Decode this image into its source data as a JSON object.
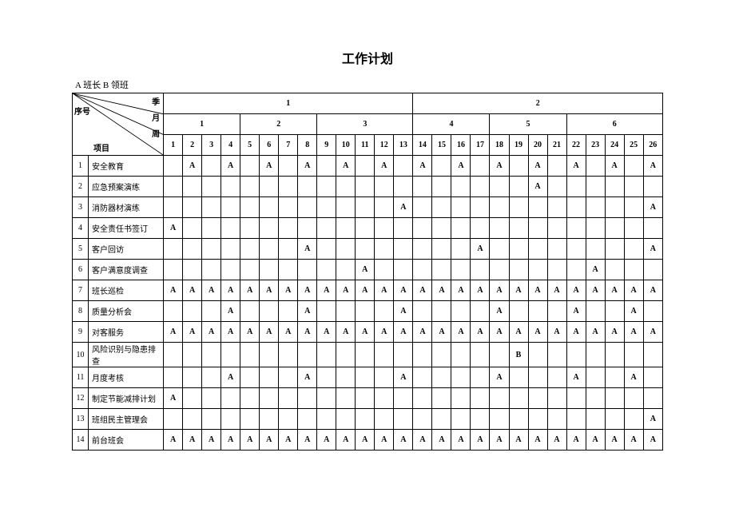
{
  "title": "工作计划",
  "legend": "A 班长   B 领班",
  "header": {
    "seq_label": "序号",
    "item_label": "项目",
    "quarter_label": "季",
    "month_label": "月",
    "week_label": "周",
    "quarters": [
      "1",
      "2"
    ],
    "months": [
      "1",
      "2",
      "3",
      "4",
      "5",
      "6"
    ],
    "weeks": [
      "1",
      "2",
      "3",
      "4",
      "5",
      "6",
      "7",
      "8",
      "9",
      "10",
      "11",
      "12",
      "13",
      "14",
      "15",
      "16",
      "17",
      "18",
      "19",
      "20",
      "21",
      "22",
      "23",
      "24",
      "25",
      "26"
    ]
  },
  "rows": [
    {
      "seq": "1",
      "item": "安全教育",
      "cells": [
        "",
        "A",
        "",
        "A",
        "",
        "A",
        "",
        "A",
        "",
        "A",
        "",
        "A",
        "",
        "A",
        "",
        "A",
        "",
        "A",
        "",
        "A",
        "",
        "A",
        "",
        "A",
        "",
        "A"
      ]
    },
    {
      "seq": "2",
      "item": "应急预案演练",
      "cells": [
        "",
        "",
        "",
        "",
        "",
        "",
        "",
        "",
        "",
        "",
        "",
        "",
        "",
        "",
        "",
        "",
        "",
        "",
        "",
        "A",
        "",
        "",
        "",
        "",
        "",
        ""
      ]
    },
    {
      "seq": "3",
      "item": "消防器材演练",
      "cells": [
        "",
        "",
        "",
        "",
        "",
        "",
        "",
        "",
        "",
        "",
        "",
        "",
        "A",
        "",
        "",
        "",
        "",
        "",
        "",
        "",
        "",
        "",
        "",
        "",
        "",
        "A"
      ]
    },
    {
      "seq": "4",
      "item": "安全责任书签订",
      "cells": [
        "A",
        "",
        "",
        "",
        "",
        "",
        "",
        "",
        "",
        "",
        "",
        "",
        "",
        "",
        "",
        "",
        "",
        "",
        "",
        "",
        "",
        "",
        "",
        "",
        "",
        ""
      ]
    },
    {
      "seq": "5",
      "item": "客户回访",
      "cells": [
        "",
        "",
        "",
        "",
        "",
        "",
        "",
        "A",
        "",
        "",
        "",
        "",
        "",
        "",
        "",
        "",
        "A",
        "",
        "",
        "",
        "",
        "",
        "",
        "",
        "",
        "A"
      ]
    },
    {
      "seq": "6",
      "item": "客户满意度调查",
      "cells": [
        "",
        "",
        "",
        "",
        "",
        "",
        "",
        "",
        "",
        "",
        "A",
        "",
        "",
        "",
        "",
        "",
        "",
        "",
        "",
        "",
        "",
        "",
        "A",
        "",
        "",
        ""
      ]
    },
    {
      "seq": "7",
      "item": "班长巡检",
      "cells": [
        "A",
        "A",
        "A",
        "A",
        "A",
        "A",
        "A",
        "A",
        "A",
        "A",
        "A",
        "A",
        "A",
        "A",
        "A",
        "A",
        "A",
        "A",
        "A",
        "A",
        "A",
        "A",
        "A",
        "A",
        "A",
        "A"
      ]
    },
    {
      "seq": "8",
      "item": "质量分析会",
      "cells": [
        "",
        "",
        "",
        "A",
        "",
        "",
        "",
        "A",
        "",
        "",
        "",
        "",
        "A",
        "",
        "",
        "",
        "",
        "A",
        "",
        "",
        "",
        "A",
        "",
        "",
        "A",
        ""
      ]
    },
    {
      "seq": "9",
      "item": "对客服务",
      "cells": [
        "A",
        "A",
        "A",
        "A",
        "A",
        "A",
        "A",
        "A",
        "A",
        "A",
        "A",
        "A",
        "A",
        "A",
        "A",
        "A",
        "A",
        "A",
        "A",
        "A",
        "A",
        "A",
        "A",
        "A",
        "A",
        "A"
      ]
    },
    {
      "seq": "10",
      "item": "风险识别与隐患排查",
      "cells": [
        "",
        "",
        "",
        "",
        "",
        "",
        "",
        "",
        "",
        "",
        "",
        "",
        "",
        "",
        "",
        "",
        "",
        "",
        "B",
        "",
        "",
        "",
        "",
        "",
        "",
        ""
      ]
    },
    {
      "seq": "11",
      "item": "月度考核",
      "cells": [
        "",
        "",
        "",
        "A",
        "",
        "",
        "",
        "A",
        "",
        "",
        "",
        "",
        "A",
        "",
        "",
        "",
        "",
        "A",
        "",
        "",
        "",
        "A",
        "",
        "",
        "A",
        ""
      ]
    },
    {
      "seq": "12",
      "item": "制定节能减排计划",
      "cells": [
        "A",
        "",
        "",
        "",
        "",
        "",
        "",
        "",
        "",
        "",
        "",
        "",
        "",
        "",
        "",
        "",
        "",
        "",
        "",
        "",
        "",
        "",
        "",
        "",
        "",
        ""
      ]
    },
    {
      "seq": "13",
      "item": "班组民主管理会",
      "cells": [
        "",
        "",
        "",
        "",
        "",
        "",
        "",
        "",
        "",
        "",
        "",
        "",
        "",
        "",
        "",
        "",
        "",
        "",
        "",
        "",
        "",
        "",
        "",
        "",
        "",
        "A"
      ]
    },
    {
      "seq": "14",
      "item": "前台班会",
      "cells": [
        "A",
        "A",
        "A",
        "A",
        "A",
        "A",
        "A",
        "A",
        "A",
        "A",
        "A",
        "A",
        "A",
        "A",
        "A",
        "A",
        "A",
        "A",
        "A",
        "A",
        "A",
        "A",
        "A",
        "A",
        "A",
        "A"
      ]
    }
  ]
}
